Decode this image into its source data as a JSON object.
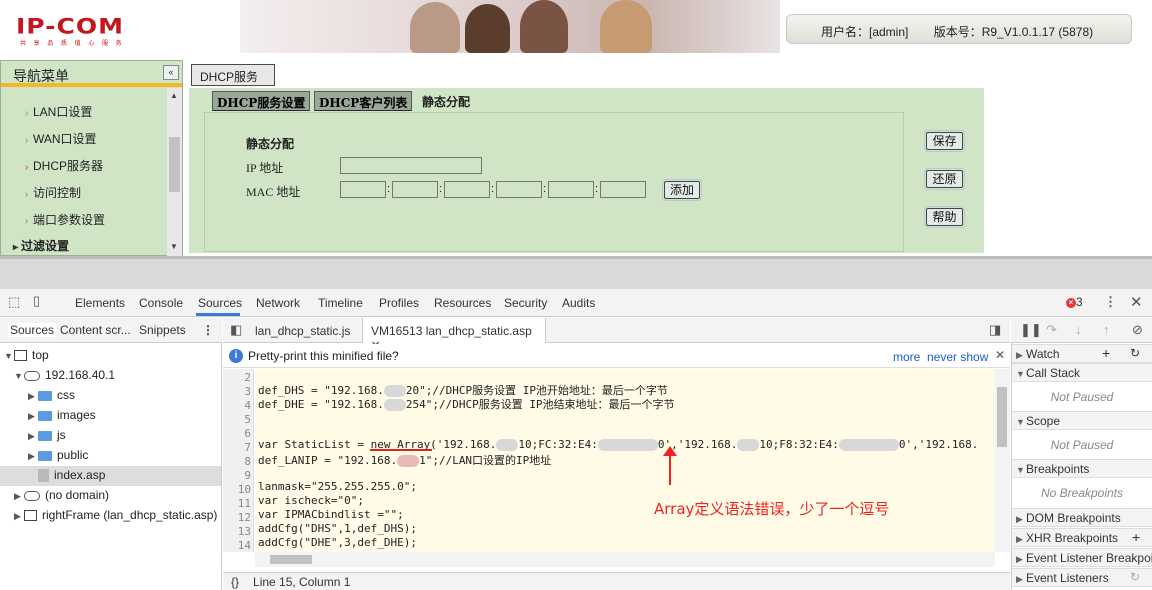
{
  "router": {
    "logo": "IP-COM",
    "logo_tagline": "共 享 品 质   值 心 服 务",
    "username_label": "用户名：[admin]",
    "version_label": "版本号：R9_V1.0.1.17 (5878)",
    "nav": {
      "title": "导航菜单",
      "collapse_glyph": "«",
      "items": [
        {
          "label": "LAN口设置"
        },
        {
          "label": "WAN口设置"
        },
        {
          "label": "DHCP服务器"
        },
        {
          "label": "访问控制"
        },
        {
          "label": "端口参数设置"
        }
      ],
      "group": "过滤设置"
    },
    "main_tab": "DHCP服务器",
    "subtabs": [
      "DHCP服务设置",
      "DHCP客户列表",
      "静态分配"
    ],
    "form": {
      "title": "静态分配",
      "ip_label": "IP 地址",
      "mac_label": "MAC 地址",
      "mac_sep": ":",
      "add_button": "添加"
    },
    "buttons": {
      "save": "保存",
      "restore": "还原",
      "help": "帮助"
    }
  },
  "devtools": {
    "tabs": [
      "Elements",
      "Console",
      "Sources",
      "Network",
      "Timeline",
      "Profiles",
      "Resources",
      "Security",
      "Audits"
    ],
    "active_tab": "Sources",
    "error_count": "3",
    "left_tabs": [
      "Sources",
      "Content scr...",
      "Snippets"
    ],
    "tree": {
      "top": "top",
      "host": "192.168.40.1",
      "folders": [
        "css",
        "images",
        "js",
        "public"
      ],
      "file": "index.asp",
      "no_domain": "(no domain)",
      "frame": "rightFrame (lan_dhcp_static.asp)"
    },
    "editor_tabs": [
      "lan_dhcp_static.js",
      "VM16513 lan_dhcp_static.asp"
    ],
    "infobar": {
      "text": "Pretty-print this minified file?",
      "more": "more",
      "never": "never show"
    },
    "code": {
      "line_numbers": [
        "2",
        "3",
        "4",
        "5",
        "6",
        "7",
        "8",
        "9",
        "10",
        "11",
        "12",
        "13",
        "14"
      ],
      "l2a": "def_DHS = \"192.168.",
      "l2b": "20\";//DHCP服务设置 IP池开始地址：最后一个字节",
      "l3a": "def_DHE = \"192.168.",
      "l3b": "254\";//DHCP服务设置 IP池结束地址：最后一个字节",
      "l6a": "var StaticList = new Array('192.168.",
      "l6b": "10;FC:32:E4:",
      "l6c": "0','192.168.",
      "l6d": "10;F8:32:E4:",
      "l6e": "0','192.168.",
      "l7a": "def_LANIP = \"192.168.",
      "l7b": "1\";//LAN口设置的IP地址",
      "l9": "lanmask=\"255.255.255.0\";",
      "l10": "var ischeck=\"0\";",
      "l11": "var IPMACbindlist =\"\";",
      "l12": "addCfg(\"DHS\",1,def_DHS);",
      "l13": "addCfg(\"DHE\",3,def_DHE);"
    },
    "annotation": "Array定义语法错误，少了一个逗号",
    "status": {
      "braces": "{}",
      "position": "Line 15, Column 1"
    },
    "right": {
      "watch": "Watch",
      "call_stack": "Call Stack",
      "not_paused": "Not Paused",
      "scope": "Scope",
      "breakpoints": "Breakpoints",
      "no_breakpoints": "No Breakpoints",
      "dom_bp": "DOM Breakpoints",
      "xhr_bp": "XHR Breakpoints",
      "event_bp": "Event Listener Breakpoints",
      "event_listeners": "Event Listeners"
    }
  }
}
